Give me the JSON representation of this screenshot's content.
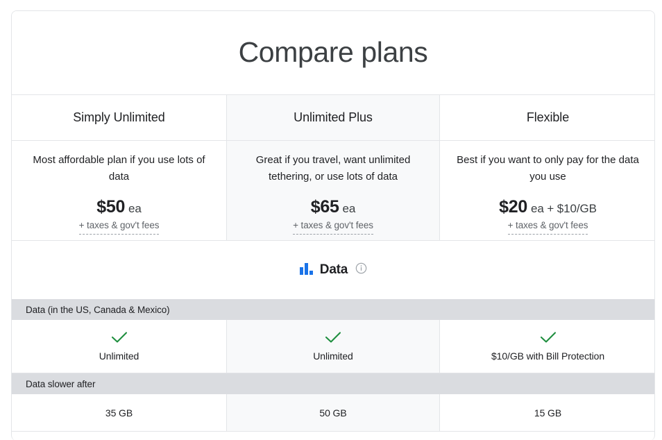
{
  "header": {
    "title": "Compare plans"
  },
  "colors": {
    "accent_blue": "#1a73e8",
    "check_green": "#1e8e3e",
    "band_gray": "#dadce0",
    "highlight_gray": "#f8f9fa",
    "border_gray": "#e3e5e8",
    "text_primary": "#202124",
    "text_secondary": "#5f6368"
  },
  "plans": [
    {
      "name": "Simply Unlimited",
      "description": "Most affordable plan if you use lots of data",
      "price_main": "$50",
      "price_suffix": "ea",
      "price_note": "+ taxes & gov't fees",
      "highlighted": false
    },
    {
      "name": "Unlimited Plus",
      "description": "Great if you travel, want unlimited tethering, or use lots of data",
      "price_main": "$65",
      "price_suffix": "ea",
      "price_note": "+ taxes & gov't fees",
      "highlighted": true
    },
    {
      "name": "Flexible",
      "description": "Best if you want to only pay for the data you use",
      "price_main": "$20",
      "price_suffix": "ea + $10/GB",
      "price_note": "+ taxes & gov't fees",
      "highlighted": false
    }
  ],
  "category": {
    "icon": "bar-chart-icon",
    "label": "Data",
    "info_icon": "info-circle-icon"
  },
  "sections": [
    {
      "band_label": "Data (in the US, Canada & Mexico)",
      "has_check": true,
      "values": [
        "Unlimited",
        "Unlimited",
        "$10/GB with Bill Protection"
      ]
    },
    {
      "band_label": "Data slower after",
      "has_check": false,
      "values": [
        "35 GB",
        "50 GB",
        "15 GB"
      ]
    }
  ]
}
